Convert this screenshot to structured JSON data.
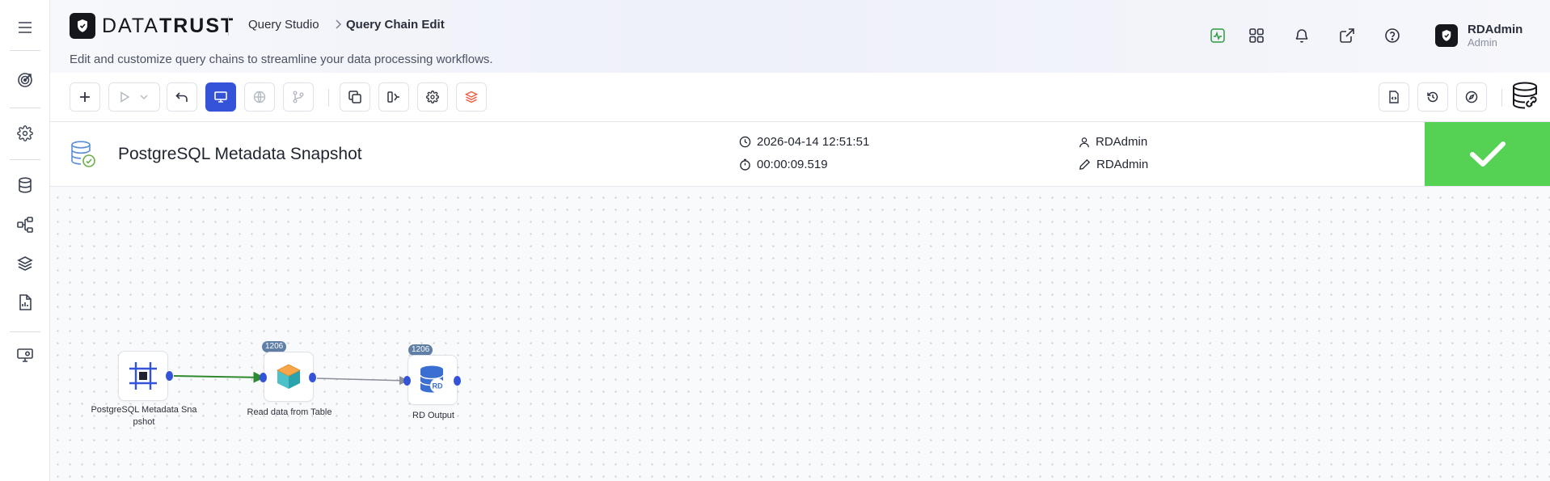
{
  "app": {
    "brand": "DATATRUST",
    "brand_light": "DATA",
    "brand_bold": "TRUST",
    "accent_color": "#3553d9",
    "success_color": "#55d154"
  },
  "breadcrumb": {
    "parent": "Query Studio",
    "current": "Query Chain Edit"
  },
  "header": {
    "subtitle": "Edit and customize query chains to streamline your data processing workflows.",
    "icons": [
      "activity-icon",
      "grid-apps-icon",
      "bell-icon",
      "external-link-icon",
      "help-icon"
    ]
  },
  "user": {
    "name": "RDAdmin",
    "role": "Admin"
  },
  "sidebar": {
    "items": [
      "menu-icon",
      "target-icon",
      "settings-icon",
      "database-icon",
      "hierarchy-icon",
      "layers-icon",
      "report-icon",
      "monitor-settings-icon"
    ]
  },
  "toolbar": {
    "left_buttons": [
      "add",
      "run",
      "run-options",
      "undo",
      "screen-view",
      "globe",
      "branch",
      "copy",
      "split-view",
      "settings",
      "layers"
    ],
    "right_buttons": [
      "file-code",
      "history",
      "compass",
      "database-link"
    ]
  },
  "query_chain": {
    "title": "PostgreSQL Metadata Snapshot",
    "datetime": "2026-04-14 12:51:51",
    "duration": "00:00:09.519",
    "created_by": "RDAdmin",
    "modified_by": "RDAdmin",
    "status": "success"
  },
  "nodes": [
    {
      "label_line1": "PostgreSQL Metadata Sna",
      "label_line2": "pshot",
      "type": "start",
      "count": ""
    },
    {
      "label_line1": "Read data from Table",
      "label_line2": "",
      "type": "read-table",
      "count": "1206"
    },
    {
      "label_line1": "RD Output",
      "label_line2": "",
      "type": "output",
      "count": "1206",
      "icon_text": "RD"
    }
  ]
}
